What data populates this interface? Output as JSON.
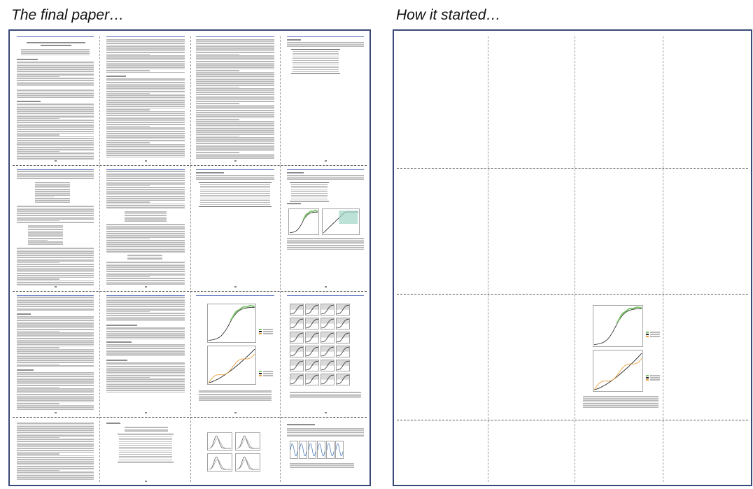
{
  "headings": {
    "left": "The final paper…",
    "right": "How it started…"
  },
  "final_paper": {
    "columns": 4,
    "rows": 4,
    "colors": {
      "frame": "#3a4a78",
      "header_rule": "#6d7fc4",
      "curve_green": "#7cc46a",
      "curve_orange": "#e8a040",
      "curve_black": "#222222"
    }
  },
  "how_it_started": {
    "columns": 4,
    "rows": 4
  }
}
